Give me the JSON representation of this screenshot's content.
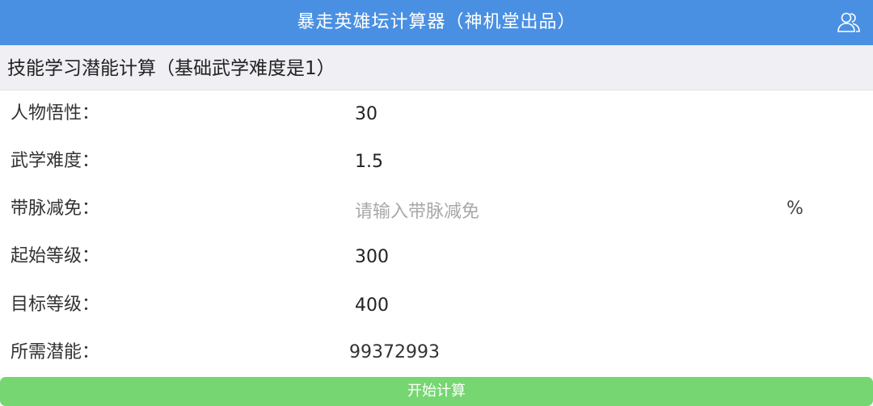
{
  "header": {
    "title": "暴走英雄坛计算器（神机堂出品）",
    "user_icon": "user-group-icon"
  },
  "section": {
    "title": "技能学习潜能计算（基础武学难度是1）"
  },
  "form": {
    "rows": [
      {
        "label": "人物悟性：",
        "value": "30",
        "placeholder": ""
      },
      {
        "label": "武学难度：",
        "value": "1.5",
        "placeholder": ""
      },
      {
        "label": "带脉减免：",
        "value": "",
        "placeholder": "请输入带脉减免",
        "unit": "%"
      },
      {
        "label": "起始等级：",
        "value": "300",
        "placeholder": ""
      },
      {
        "label": "目标等级：",
        "value": "400",
        "placeholder": ""
      }
    ],
    "result": {
      "label": "所需潜能：",
      "value": "99372993"
    }
  },
  "actions": {
    "calculate_label": "开始计算"
  },
  "colors": {
    "header_bg": "#4a90e2",
    "section_bg": "#efeff4",
    "button_bg": "#76d672"
  }
}
